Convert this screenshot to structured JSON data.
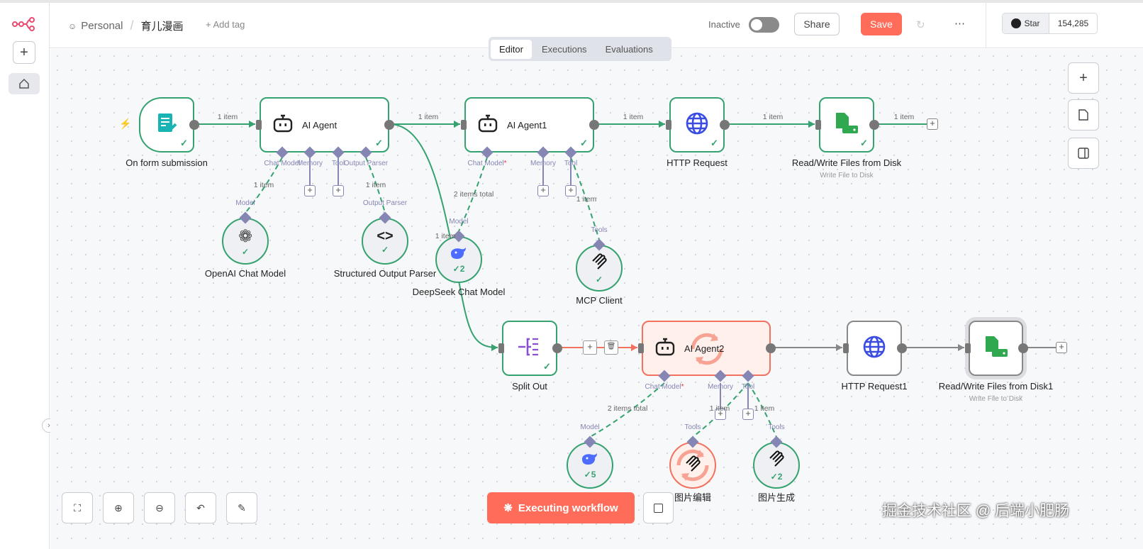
{
  "header": {
    "project": "Personal",
    "workflow_name": "育儿漫画",
    "add_tag": "+ Add tag",
    "active_label": "Inactive",
    "active": false,
    "share": "Share",
    "save": "Save",
    "star": "Star",
    "star_count": "154,285"
  },
  "tabs": [
    {
      "label": "Editor",
      "active": true
    },
    {
      "label": "Executions",
      "active": false
    },
    {
      "label": "Evaluations",
      "active": false
    }
  ],
  "colors": {
    "accent": "#ff6d5a",
    "success": "#35a26f",
    "handle": "#8586b3",
    "running": "#f0725f"
  },
  "nodes": [
    {
      "id": "form",
      "label": "On form submission",
      "icon": "form-icon",
      "status": "success"
    },
    {
      "id": "agent",
      "label": "AI Agent",
      "icon": "robot-icon",
      "status": "success",
      "handles": [
        "Chat Model",
        "Memory",
        "Tool",
        "Output Parser"
      ]
    },
    {
      "id": "agent1",
      "label": "AI Agent1",
      "icon": "robot-icon",
      "status": "success",
      "handles": [
        "Chat Model",
        "Memory",
        "Tool"
      ],
      "required": "*"
    },
    {
      "id": "http",
      "label": "HTTP Request",
      "icon": "globe-icon",
      "status": "success"
    },
    {
      "id": "rw",
      "label": "Read/Write Files from Disk",
      "subtitle": "Write File to Disk",
      "icon": "file-disk-icon",
      "status": "success"
    },
    {
      "id": "split",
      "label": "Split Out",
      "icon": "split-icon",
      "status": "success"
    },
    {
      "id": "agent2",
      "label": "AI Agent2",
      "icon": "robot-icon",
      "status": "running",
      "handles": [
        "Chat Model",
        "Memory",
        "Tool"
      ],
      "required": "*"
    },
    {
      "id": "http1",
      "label": "HTTP Request1",
      "icon": "globe-icon",
      "status": "idle"
    },
    {
      "id": "rw1",
      "label": "Read/Write Files from Disk1",
      "subtitle": "Write File to Disk",
      "icon": "file-disk-icon",
      "status": "idle"
    }
  ],
  "subnodes": [
    {
      "id": "openai",
      "label": "OpenAI Chat Model",
      "top": "Model",
      "icon": "openai-icon",
      "status": "success"
    },
    {
      "id": "parser",
      "label": "Structured Output Parser",
      "top": "Output Parser",
      "icon": "code-icon",
      "status": "success"
    },
    {
      "id": "deepseek",
      "label": "DeepSeek Chat Model",
      "top": "Model",
      "icon": "deepseek-icon",
      "status": "success",
      "count": "2"
    },
    {
      "id": "mcp",
      "label": "MCP Client",
      "top": "Tools",
      "icon": "mcp-icon",
      "status": "success"
    },
    {
      "id": "deepseek2",
      "label": "",
      "top": "Model",
      "icon": "deepseek-icon",
      "status": "success",
      "count": "5"
    },
    {
      "id": "edit",
      "label": "图片编辑",
      "top": "Tools",
      "icon": "mcp-icon",
      "status": "running"
    },
    {
      "id": "gen",
      "label": "图片生成",
      "top": "Tools",
      "icon": "mcp-icon",
      "status": "success",
      "count": "2"
    }
  ],
  "edge_labels": {
    "e1": "1 item",
    "e2": "1 item",
    "e3": "1 item",
    "e4": "1 item",
    "e5": "1 item",
    "d1": "1 item",
    "d2": "1 item",
    "d3": "2 items total",
    "d3b": "1 item",
    "d4": "1 item",
    "d5": "2 items total",
    "d6": "1 item",
    "d7": "1 item"
  },
  "footer": {
    "execute": "Executing workflow"
  },
  "watermark": "掘金技术社区 @ 后端小肥肠"
}
